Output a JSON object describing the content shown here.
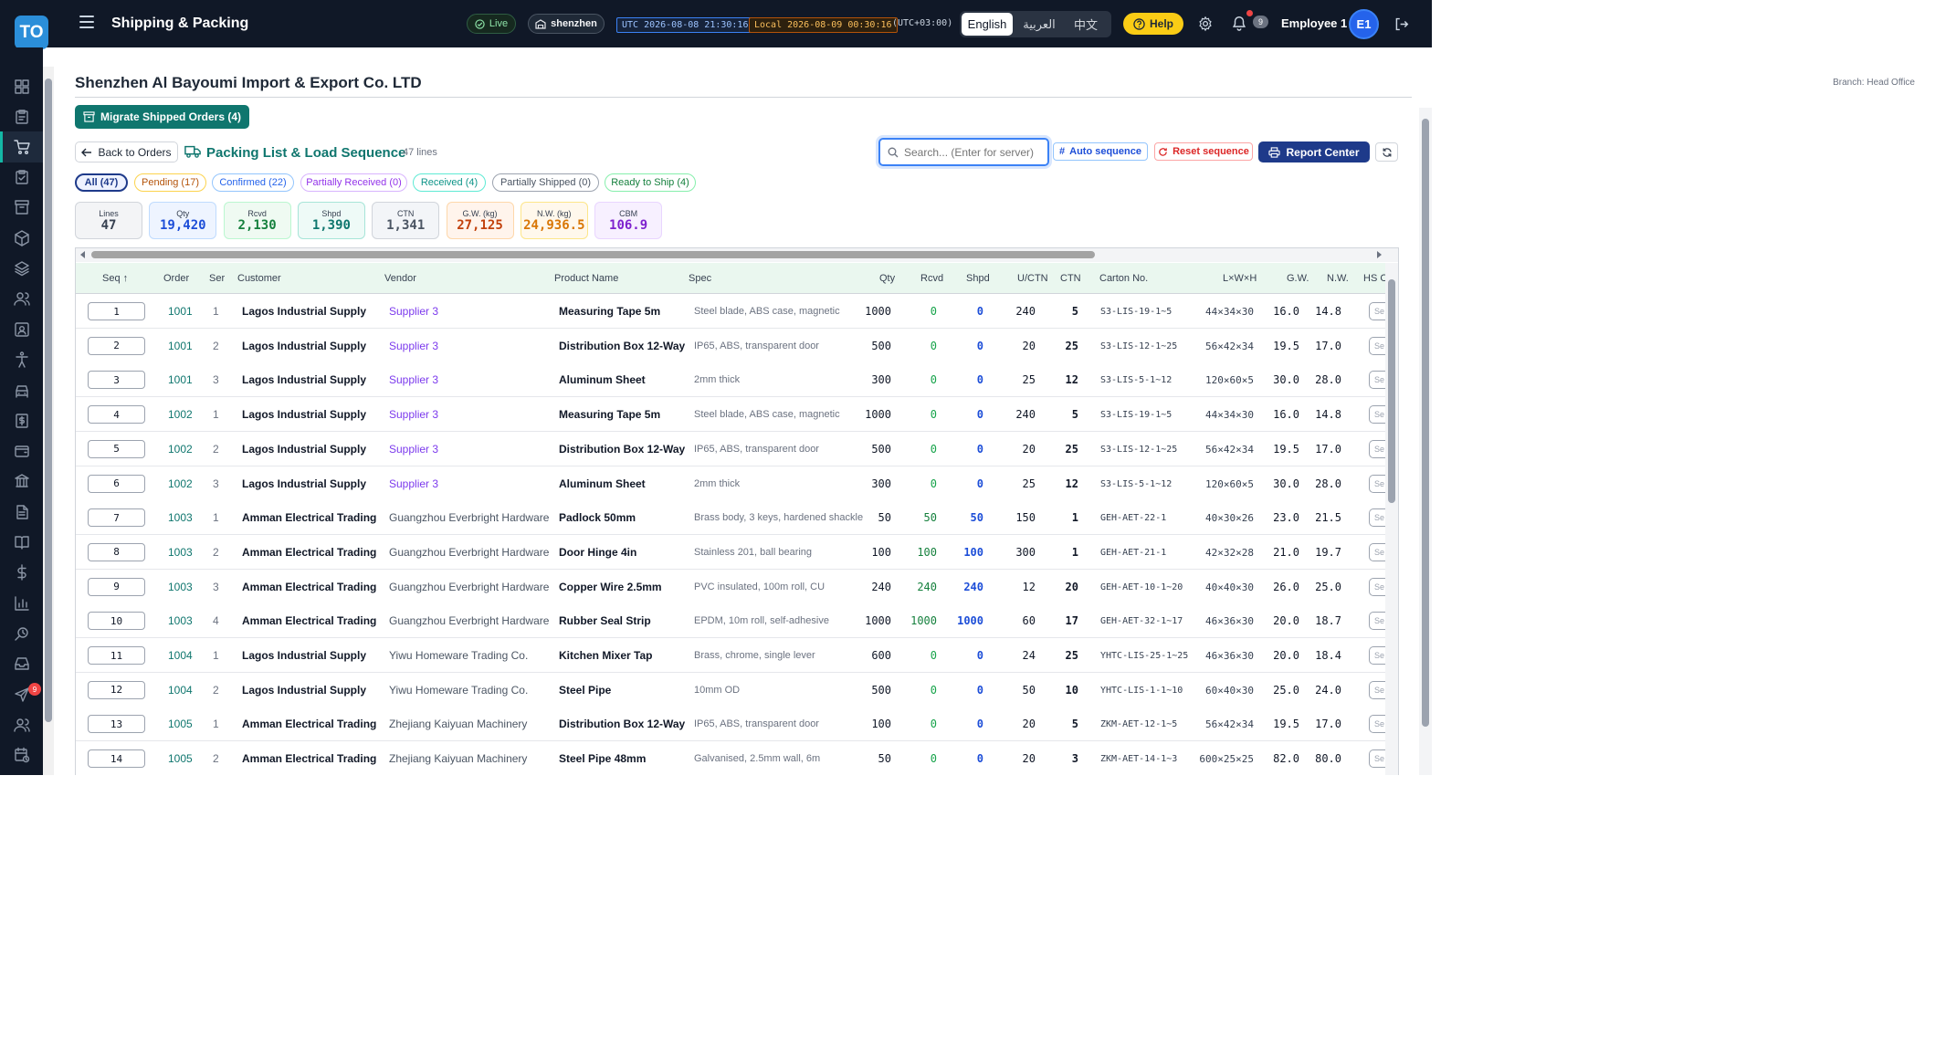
{
  "header": {
    "logo": "TO",
    "app_title": "Shipping & Packing",
    "live_label": "Live",
    "warehouse": "shenzhen",
    "utc_time": "UTC 2026-08-08 21:30:16",
    "local_time": "Local 2026-08-09 00:30:16",
    "tz_offset": "(UTC+03:00)",
    "languages": [
      "English",
      "العربية",
      "中文"
    ],
    "active_language": "English",
    "help_label": "Help",
    "notification_count": "9",
    "user_name": "Employee 1",
    "avatar_initials": "E1"
  },
  "sidebar": {
    "icons": [
      "dashboard-icon",
      "clipboard-icon",
      "cart-icon",
      "clipboard-check-icon",
      "archive-icon",
      "box-icon",
      "layers-icon",
      "users-icon",
      "contact-card-icon",
      "accessibility-icon",
      "car-icon",
      "dollar-doc-icon",
      "wallet-icon",
      "bank-icon",
      "document-icon",
      "book-icon",
      "dollar-icon",
      "bar-chart-icon",
      "search-history-icon",
      "inbox-icon",
      "send-icon",
      "team-icon",
      "calendar-clock-icon"
    ],
    "active_index": 2,
    "badge": "9"
  },
  "page": {
    "company": "Shenzhen Al Bayoumi Import & Export Co. LTD",
    "branch": "Branch: Head Office",
    "migrate_label": "Migrate Shipped Orders (4)",
    "back_label": "Back to Orders",
    "title": "Packing List & Load Sequence",
    "lines_count": "47 lines",
    "search_placeholder": "Search... (Enter for server)",
    "auto_sequence_label": "Auto sequence",
    "reset_sequence_label": "Reset sequence",
    "report_center_label": "Report Center"
  },
  "filters": [
    {
      "label": "All (47)",
      "color": "#1e3a8a",
      "border": "#1e3a8a",
      "active": true
    },
    {
      "label": "Pending (17)",
      "color": "#b45309",
      "border": "#fcd34d"
    },
    {
      "label": "Confirmed (22)",
      "color": "#2563eb",
      "border": "#93c5fd"
    },
    {
      "label": "Partially Received (0)",
      "color": "#9333ea",
      "border": "#d8b4fe"
    },
    {
      "label": "Received (4)",
      "color": "#0d9488",
      "border": "#5eead4"
    },
    {
      "label": "Partially Shipped (0)",
      "color": "#4b5563",
      "border": "#9ca3af"
    },
    {
      "label": "Ready to Ship (4)",
      "color": "#15803d",
      "border": "#86efac"
    }
  ],
  "kpis": [
    {
      "label": "Lines",
      "value": "47",
      "color": "#374151",
      "bg": "#f3f4f6",
      "border": "#d1d5db"
    },
    {
      "label": "Qty",
      "value": "19,420",
      "color": "#1d4ed8",
      "bg": "#eef4ff",
      "border": "#bfdbfe"
    },
    {
      "label": "Rcvd",
      "value": "2,130",
      "color": "#15803d",
      "bg": "#effaf2",
      "border": "#bbf7d0"
    },
    {
      "label": "Shpd",
      "value": "1,390",
      "color": "#0f766e",
      "bg": "#eefaf7",
      "border": "#a7e5d8"
    },
    {
      "label": "CTN",
      "value": "1,341",
      "color": "#4b5563",
      "bg": "#f3f5f8",
      "border": "#d1d5db"
    },
    {
      "label": "G.W. (kg)",
      "value": "27,125",
      "color": "#c2410c",
      "bg": "#fff4ec",
      "border": "#fed7aa"
    },
    {
      "label": "N.W. (kg)",
      "value": "24,936.5",
      "color": "#d97706",
      "bg": "#fff8ec",
      "border": "#fde68a"
    },
    {
      "label": "CBM",
      "value": "106.9",
      "color": "#7e22ce",
      "bg": "#f7f0ff",
      "border": "#e9d5ff"
    }
  ],
  "table": {
    "columns": [
      "Seq ↑",
      "Order",
      "Ser",
      "Customer",
      "Vendor",
      "Product Name",
      "Spec",
      "Qty",
      "Rcvd",
      "Shpd",
      "U/CTN",
      "CTN",
      "Carton No.",
      "L×W×H",
      "G.W.",
      "N.W.",
      "HS C"
    ],
    "hs_button_label": "Se",
    "rows": [
      {
        "seq": "1",
        "order": "1001",
        "ser": "1",
        "customer": "Lagos Industrial Supply",
        "vendor": "Supplier 3",
        "product": "Measuring Tape 5m",
        "spec": "Steel blade, ABS case, magnetic",
        "qty": "1000",
        "rcvd": "0",
        "shpd": "0",
        "uctn": "240",
        "ctn": "5",
        "carton": "S3-LIS-19-1~5",
        "dims": "44×34×30",
        "gw": "16.0",
        "nw": "14.8"
      },
      {
        "seq": "2",
        "order": "1001",
        "ser": "2",
        "customer": "Lagos Industrial Supply",
        "vendor": "Supplier 3",
        "product": "Distribution Box 12-Way",
        "spec": "IP65, ABS, transparent door",
        "qty": "500",
        "rcvd": "0",
        "shpd": "0",
        "uctn": "20",
        "ctn": "25",
        "carton": "S3-LIS-12-1~25",
        "dims": "56×42×34",
        "gw": "19.5",
        "nw": "17.0"
      },
      {
        "seq": "3",
        "order": "1001",
        "ser": "3",
        "customer": "Lagos Industrial Supply",
        "vendor": "Supplier 3",
        "product": "Aluminum Sheet",
        "spec": "2mm thick",
        "qty": "300",
        "rcvd": "0",
        "shpd": "0",
        "uctn": "25",
        "ctn": "12",
        "carton": "S3-LIS-5-1~12",
        "dims": "120×60×5",
        "gw": "30.0",
        "nw": "28.0"
      },
      {
        "seq": "4",
        "order": "1002",
        "ser": "1",
        "customer": "Lagos Industrial Supply",
        "vendor": "Supplier 3",
        "product": "Measuring Tape 5m",
        "spec": "Steel blade, ABS case, magnetic",
        "qty": "1000",
        "rcvd": "0",
        "shpd": "0",
        "uctn": "240",
        "ctn": "5",
        "carton": "S3-LIS-19-1~5",
        "dims": "44×34×30",
        "gw": "16.0",
        "nw": "14.8"
      },
      {
        "seq": "5",
        "order": "1002",
        "ser": "2",
        "customer": "Lagos Industrial Supply",
        "vendor": "Supplier 3",
        "product": "Distribution Box 12-Way",
        "spec": "IP65, ABS, transparent door",
        "qty": "500",
        "rcvd": "0",
        "shpd": "0",
        "uctn": "20",
        "ctn": "25",
        "carton": "S3-LIS-12-1~25",
        "dims": "56×42×34",
        "gw": "19.5",
        "nw": "17.0"
      },
      {
        "seq": "6",
        "order": "1002",
        "ser": "3",
        "customer": "Lagos Industrial Supply",
        "vendor": "Supplier 3",
        "product": "Aluminum Sheet",
        "spec": "2mm thick",
        "qty": "300",
        "rcvd": "0",
        "shpd": "0",
        "uctn": "25",
        "ctn": "12",
        "carton": "S3-LIS-5-1~12",
        "dims": "120×60×5",
        "gw": "30.0",
        "nw": "28.0"
      },
      {
        "seq": "7",
        "order": "1003",
        "ser": "1",
        "customer": "Amman Electrical Trading",
        "vendor": "Guangzhou Everbright Hardware",
        "product": "Padlock 50mm",
        "spec": "Brass body, 3 keys, hardened shackle",
        "qty": "50",
        "rcvd": "50",
        "shpd": "50",
        "uctn": "150",
        "ctn": "1",
        "carton": "GEH-AET-22-1",
        "dims": "40×30×26",
        "gw": "23.0",
        "nw": "21.5"
      },
      {
        "seq": "8",
        "order": "1003",
        "ser": "2",
        "customer": "Amman Electrical Trading",
        "vendor": "Guangzhou Everbright Hardware",
        "product": "Door Hinge 4in",
        "spec": "Stainless 201, ball bearing",
        "qty": "100",
        "rcvd": "100",
        "shpd": "100",
        "uctn": "300",
        "ctn": "1",
        "carton": "GEH-AET-21-1",
        "dims": "42×32×28",
        "gw": "21.0",
        "nw": "19.7"
      },
      {
        "seq": "9",
        "order": "1003",
        "ser": "3",
        "customer": "Amman Electrical Trading",
        "vendor": "Guangzhou Everbright Hardware",
        "product": "Copper Wire 2.5mm",
        "spec": "PVC insulated, 100m roll, CU",
        "qty": "240",
        "rcvd": "240",
        "shpd": "240",
        "uctn": "12",
        "ctn": "20",
        "carton": "GEH-AET-10-1~20",
        "dims": "40×40×30",
        "gw": "26.0",
        "nw": "25.0"
      },
      {
        "seq": "10",
        "order": "1003",
        "ser": "4",
        "customer": "Amman Electrical Trading",
        "vendor": "Guangzhou Everbright Hardware",
        "product": "Rubber Seal Strip",
        "spec": "EPDM, 10m roll, self-adhesive",
        "qty": "1000",
        "rcvd": "1000",
        "shpd": "1000",
        "uctn": "60",
        "ctn": "17",
        "carton": "GEH-AET-32-1~17",
        "dims": "46×36×30",
        "gw": "20.0",
        "nw": "18.7"
      },
      {
        "seq": "11",
        "order": "1004",
        "ser": "1",
        "customer": "Lagos Industrial Supply",
        "vendor": "Yiwu Homeware Trading Co.",
        "product": "Kitchen Mixer Tap",
        "spec": "Brass, chrome, single lever",
        "qty": "600",
        "rcvd": "0",
        "shpd": "0",
        "uctn": "24",
        "ctn": "25",
        "carton": "YHTC-LIS-25-1~25",
        "dims": "46×36×30",
        "gw": "20.0",
        "nw": "18.4"
      },
      {
        "seq": "12",
        "order": "1004",
        "ser": "2",
        "customer": "Lagos Industrial Supply",
        "vendor": "Yiwu Homeware Trading Co.",
        "product": "Steel Pipe",
        "spec": "10mm OD",
        "qty": "500",
        "rcvd": "0",
        "shpd": "0",
        "uctn": "50",
        "ctn": "10",
        "carton": "YHTC-LIS-1-1~10",
        "dims": "60×40×30",
        "gw": "25.0",
        "nw": "24.0"
      },
      {
        "seq": "13",
        "order": "1005",
        "ser": "1",
        "customer": "Amman Electrical Trading",
        "vendor": "Zhejiang Kaiyuan Machinery",
        "product": "Distribution Box 12-Way",
        "spec": "IP65, ABS, transparent door",
        "qty": "100",
        "rcvd": "0",
        "shpd": "0",
        "uctn": "20",
        "ctn": "5",
        "carton": "ZKM-AET-12-1~5",
        "dims": "56×42×34",
        "gw": "19.5",
        "nw": "17.0"
      },
      {
        "seq": "14",
        "order": "1005",
        "ser": "2",
        "customer": "Amman Electrical Trading",
        "vendor": "Zhejiang Kaiyuan Machinery",
        "product": "Steel Pipe 48mm",
        "spec": "Galvanised, 2.5mm wall, 6m",
        "qty": "50",
        "rcvd": "0",
        "shpd": "0",
        "uctn": "20",
        "ctn": "3",
        "carton": "ZKM-AET-14-1~3",
        "dims": "600×25×25",
        "gw": "82.0",
        "nw": "80.0"
      }
    ]
  }
}
